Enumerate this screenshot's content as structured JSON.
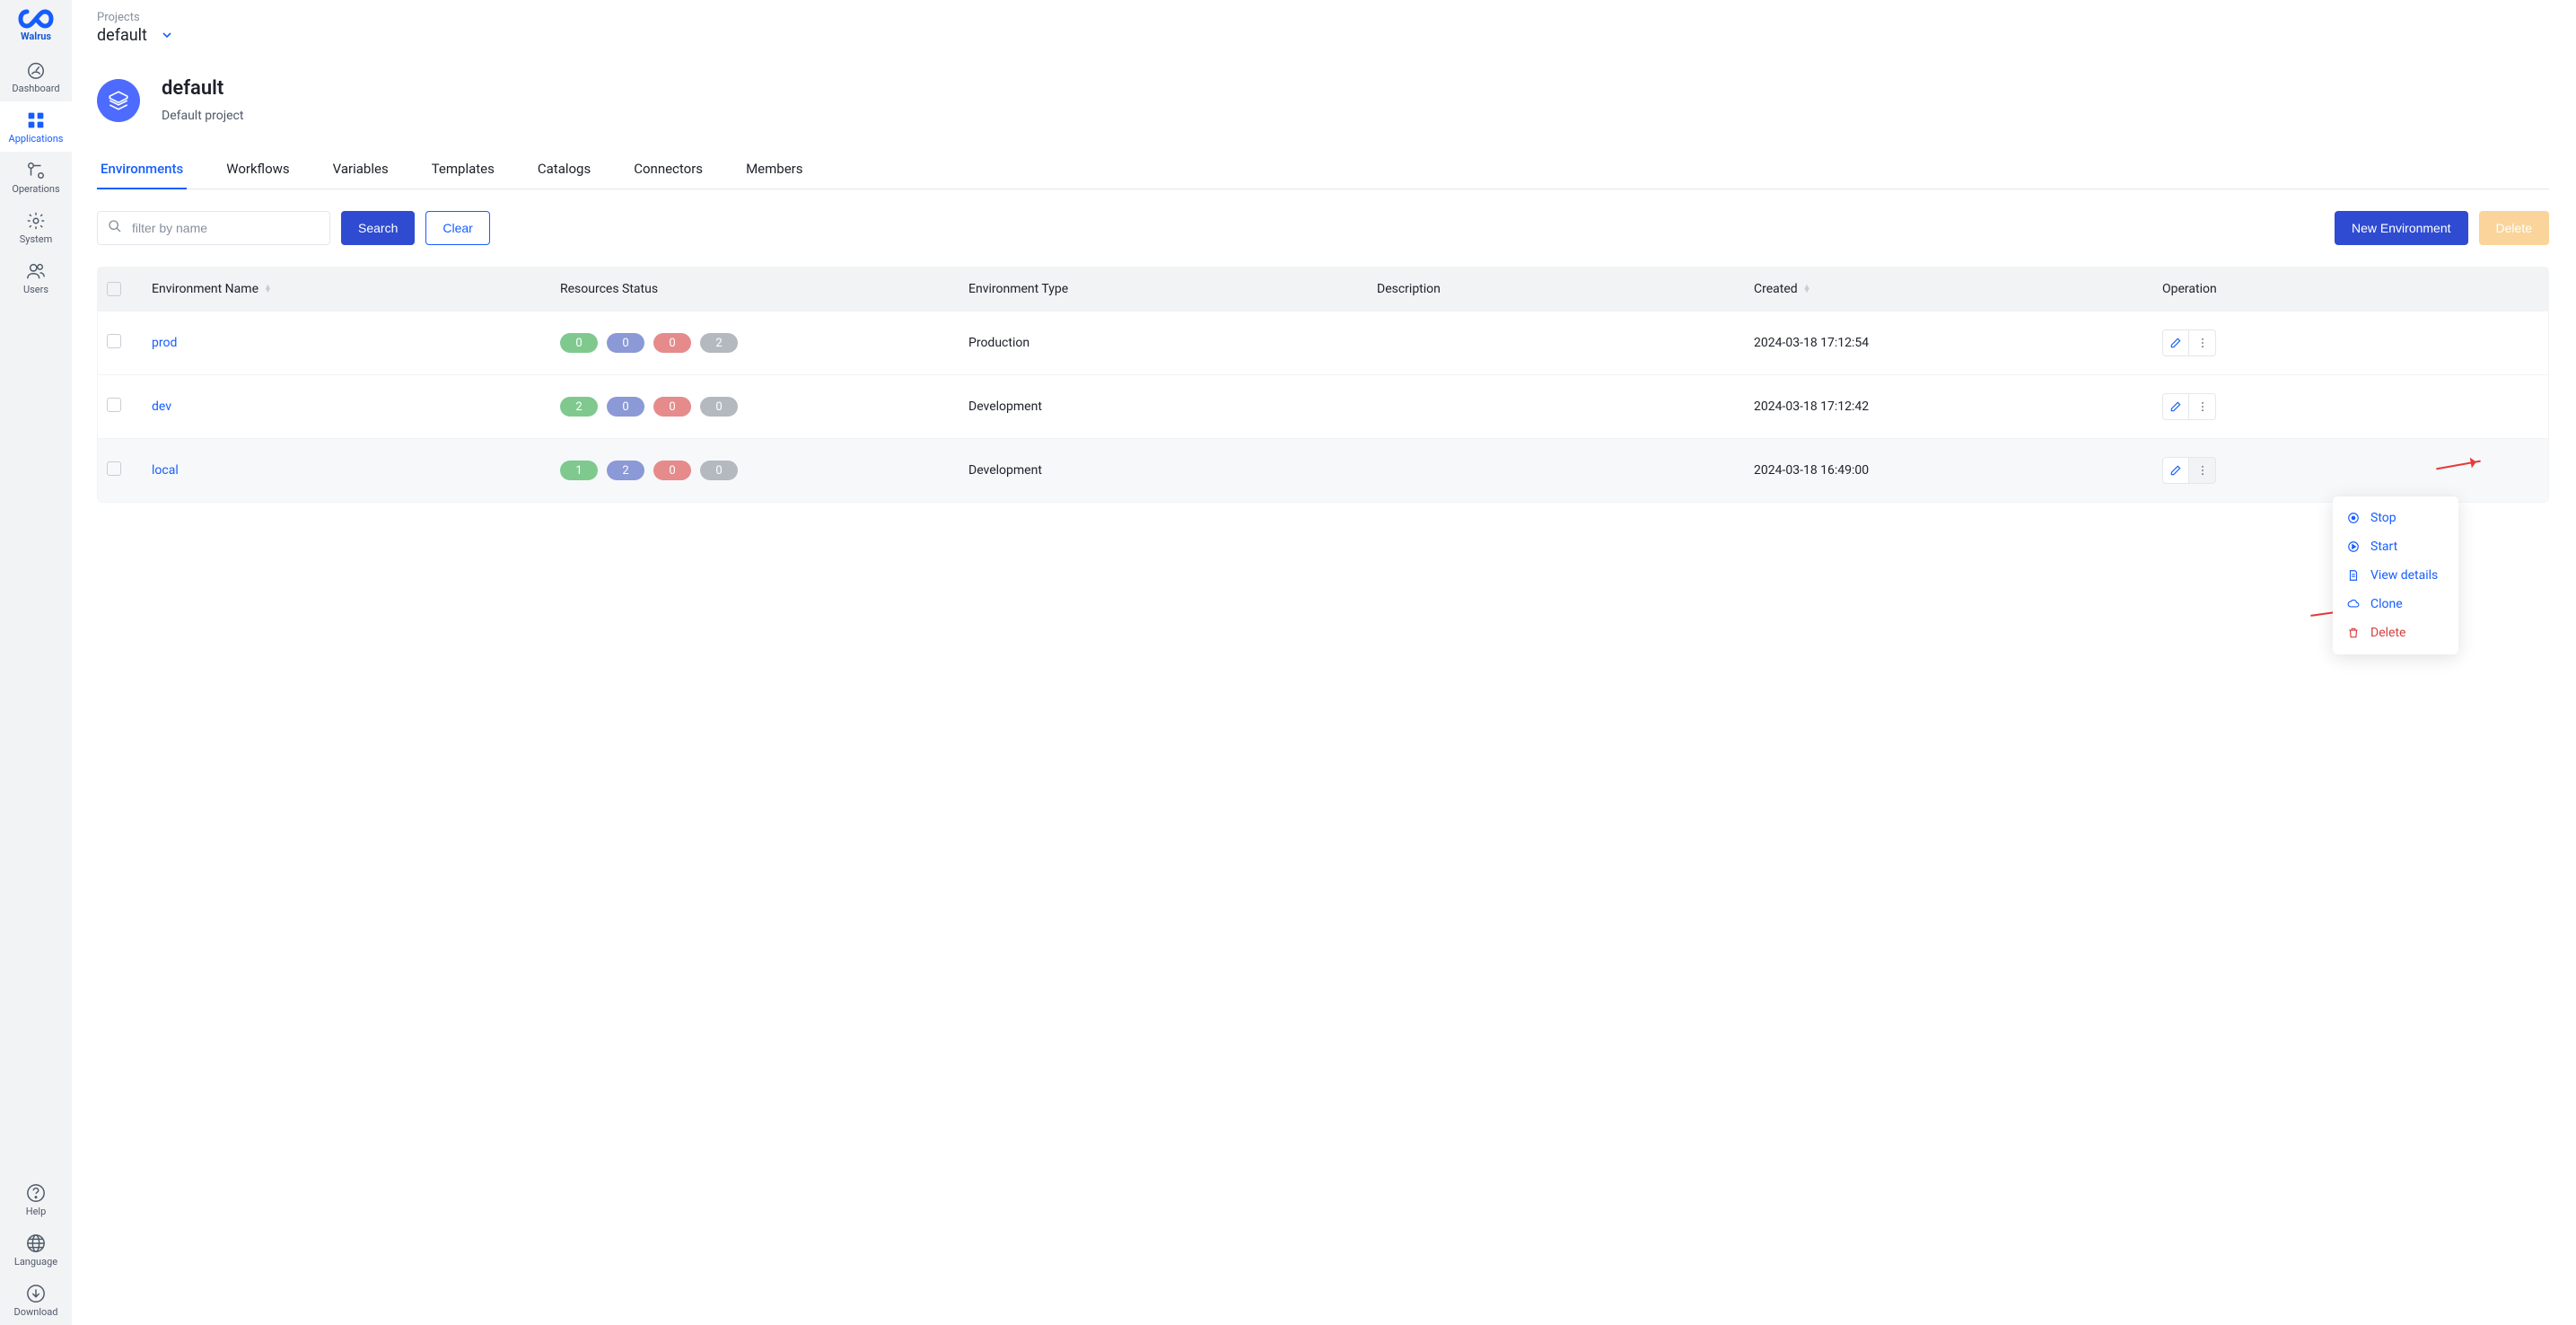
{
  "brand": "Walrus",
  "sidebar": {
    "top": [
      {
        "label": "Dashboard"
      },
      {
        "label": "Applications"
      },
      {
        "label": "Operations"
      },
      {
        "label": "System"
      },
      {
        "label": "Users"
      }
    ],
    "bottom": [
      {
        "label": "Help"
      },
      {
        "label": "Language"
      },
      {
        "label": "Download"
      }
    ]
  },
  "breadcrumb": "Projects",
  "project_selector": "default",
  "project": {
    "title": "default",
    "description": "Default project"
  },
  "tabs": [
    {
      "label": "Environments"
    },
    {
      "label": "Workflows"
    },
    {
      "label": "Variables"
    },
    {
      "label": "Templates"
    },
    {
      "label": "Catalogs"
    },
    {
      "label": "Connectors"
    },
    {
      "label": "Members"
    }
  ],
  "toolbar": {
    "search_placeholder": "filter by name",
    "search_btn": "Search",
    "clear_btn": "Clear",
    "new_btn": "New Environment",
    "delete_btn": "Delete"
  },
  "columns": {
    "name": "Environment Name",
    "status": "Resources Status",
    "type": "Environment Type",
    "desc": "Description",
    "created": "Created",
    "op": "Operation"
  },
  "rows": [
    {
      "name": "prod",
      "badges": [
        "0",
        "0",
        "0",
        "2"
      ],
      "type": "Production",
      "desc": "",
      "created": "2024-03-18 17:12:54"
    },
    {
      "name": "dev",
      "badges": [
        "2",
        "0",
        "0",
        "0"
      ],
      "type": "Development",
      "desc": "",
      "created": "2024-03-18 17:12:42"
    },
    {
      "name": "local",
      "badges": [
        "1",
        "2",
        "0",
        "0"
      ],
      "type": "Development",
      "desc": "",
      "created": "2024-03-18 16:49:00"
    }
  ],
  "menu": {
    "stop": "Stop",
    "start": "Start",
    "details": "View details",
    "clone": "Clone",
    "delete": "Delete"
  }
}
